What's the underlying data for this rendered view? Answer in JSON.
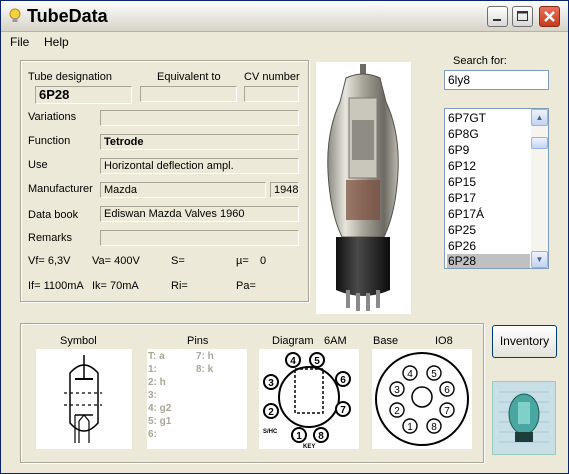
{
  "window": {
    "title": "TubeData"
  },
  "menu": {
    "file": "File",
    "help": "Help"
  },
  "details": {
    "tube_designation_label": "Tube designation",
    "equivalent_label": "Equivalent to",
    "cv_label": "CV number",
    "tube_designation": "6P28",
    "equivalent": "",
    "cv_number": "",
    "variations_label": "Variations",
    "variations": "",
    "function_label": "Function",
    "function": "Tetrode",
    "use_label": "Use",
    "use": "Horizontal deflection ampl.",
    "manufacturer_label": "Manufacturer",
    "manufacturer": "Mazda",
    "year": "1948",
    "databook_label": "Data book",
    "databook": "Ediswan Mazda Valves 1960",
    "remarks_label": "Remarks",
    "remarks": "",
    "vf": "Vf= 6,3V",
    "va": "Va= 400V",
    "s": "S=",
    "mu": "µ=",
    "mu_value": "0",
    "if": "If= 1100mA",
    "ik": "Ik= 70mA",
    "ri": "Ri=",
    "pa": "Pa="
  },
  "search": {
    "label": "Search for:",
    "value": "6ly8"
  },
  "tube_list": [
    "6P7GT",
    "6P8G",
    "6P9",
    "6P12",
    "6P15",
    "6P17",
    "6P17Á",
    "6P25",
    "6P26",
    "6P28"
  ],
  "selected_tube": "6P28",
  "bottom": {
    "symbol_label": "Symbol",
    "pins_label": "Pins",
    "diagram_label": "Diagram",
    "diagram_code": "6AM",
    "base_label": "Base",
    "base_code": "IO8",
    "pins": [
      "T: a",
      "1:",
      "2: h",
      "3:",
      "4: g2",
      "5: g1",
      "6:",
      "7: h",
      "8: k"
    ],
    "diagram_text": "S/HC I.C. KEY"
  },
  "buttons": {
    "inventory": "Inventory"
  },
  "colors": {
    "title_text": "#000000",
    "selection": "#c0c0c0",
    "close_button": "#d9482a"
  }
}
